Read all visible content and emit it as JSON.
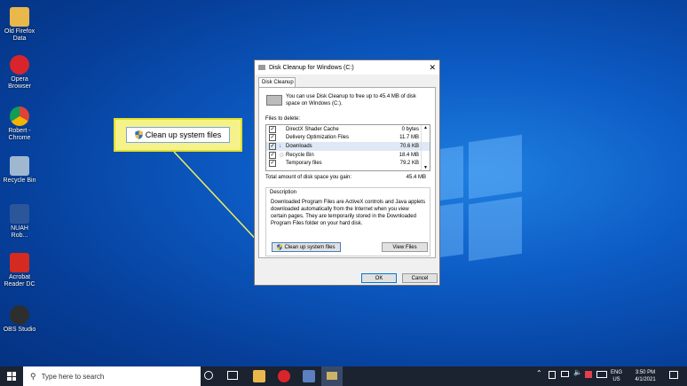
{
  "desktop": {
    "icons": [
      {
        "label": "Old Firefox Data",
        "color": "#e8b84a"
      },
      {
        "label": "Opera Browser",
        "color": "#d9242c"
      },
      {
        "label": "Robert - Chrome",
        "color": "#4caf50"
      },
      {
        "label": "Recycle Bin",
        "color": "#9fb8d0"
      },
      {
        "label": "NUAH Rob...",
        "color": "#2b579a"
      },
      {
        "label": "Acrobat Reader DC",
        "color": "#d42a1f"
      },
      {
        "label": "OBS Studio",
        "color": "#2e2e2e"
      }
    ]
  },
  "callout": {
    "button_label": "Clean up system files"
  },
  "dialog": {
    "title": "Disk Cleanup for Windows (C:)",
    "tab": "Disk Cleanup",
    "intro": "You can use Disk Cleanup to free up to 45.4 MB of disk space on Windows (C:).",
    "files_label": "Files to delete:",
    "files": [
      {
        "name": "DirectX Shader Cache",
        "size": "0 bytes",
        "checked": "✓"
      },
      {
        "name": "Delivery Optimization Files",
        "size": "11.7 MB",
        "checked": "✓"
      },
      {
        "name": "Downloads",
        "size": "70.6 KB",
        "checked": "✓"
      },
      {
        "name": "Recycle Bin",
        "size": "18.4 MB",
        "checked": "✓"
      },
      {
        "name": "Temporary files",
        "size": "79.2 KB",
        "checked": "✓"
      }
    ],
    "total_label": "Total amount of disk space you gain:",
    "total_value": "45.4 MB",
    "description_label": "Description",
    "description": "Downloaded Program Files are ActiveX controls and Java applets downloaded automatically from the Internet when you view certain pages. They are temporarily stored in the Downloaded Program Files folder on your hard disk.",
    "cleanup_button": "Clean up system files",
    "view_files_button": "View Files",
    "ok_button": "OK",
    "cancel_button": "Cancel",
    "close_glyph": "✕"
  },
  "taskbar": {
    "search_placeholder": "Type here to search",
    "language": "ENG",
    "region": "US",
    "time": "3:50 PM",
    "date": "4/1/2021"
  },
  "colors": {
    "accent": "#0078d7",
    "callout": "#f6f28a",
    "desktop": "#0c5bc4"
  }
}
